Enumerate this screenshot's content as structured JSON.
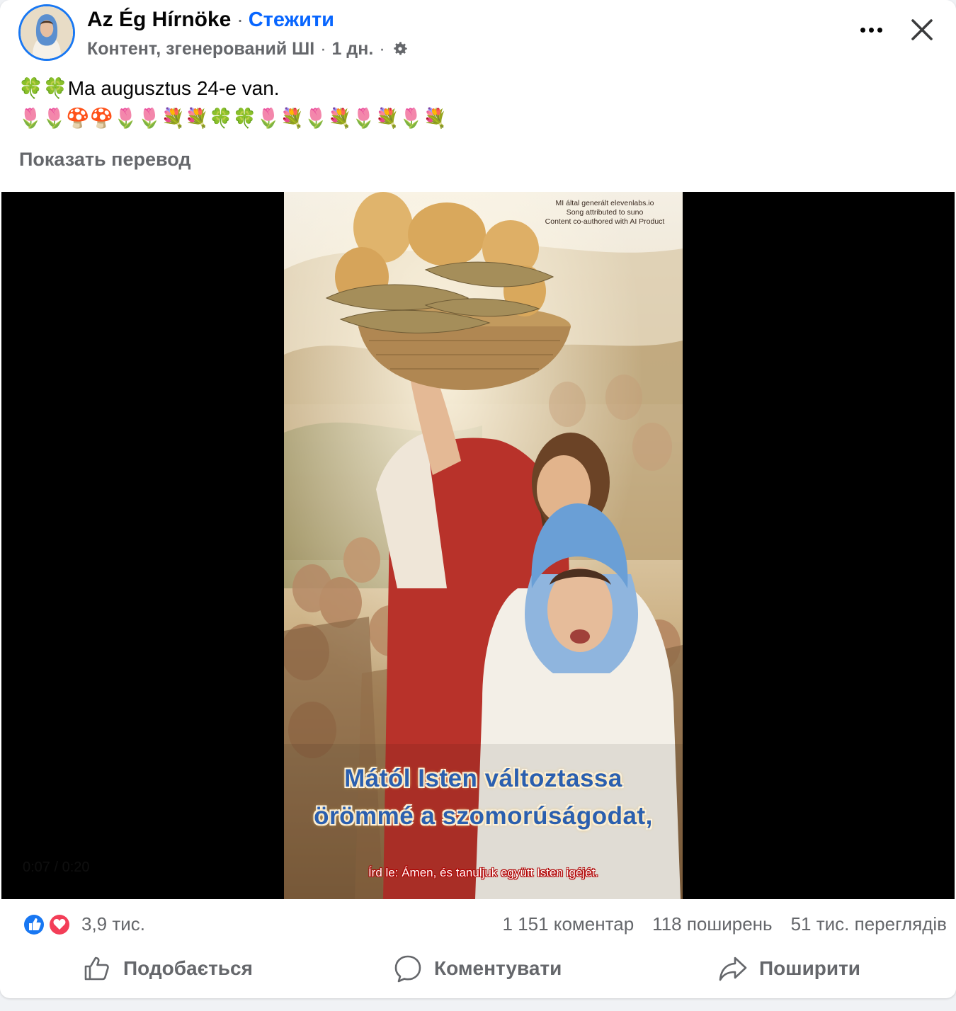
{
  "post": {
    "author": "Az Ég Hírnöke",
    "separator": "·",
    "follow_label": "Стежити",
    "meta": {
      "ai_label": "Контент, згенерований ШІ",
      "time": "1 дн.",
      "sep": "·"
    },
    "text_line1": "🍀🍀Ma augusztus 24-e van.",
    "text_line2": "🌷🌷🍄🍄🌷🌷💐💐🍀🍀🌷💐🌷💐🌷💐🌷💐",
    "see_translation": "Показать перевод"
  },
  "video": {
    "watermark": [
      "MI által generált elevenlabs.io",
      "Song attributed to suno",
      "Content co-authored with AI Product"
    ],
    "caption_line1": "Mától Isten változtassa",
    "caption_line2": "örömmé a szomorúságodat,",
    "subtitle": "Írd le: Ámen, és tanuljuk együtt Isten igéjét.",
    "player_time": "0:07 / 0:20"
  },
  "stats": {
    "reactions_count": "3,9 тис.",
    "comments": "1 151 коментар",
    "shares": "118 поширень",
    "views": "51 тис. переглядів"
  },
  "actions": {
    "like": "Подобається",
    "comment": "Коментувати",
    "share": "Поширити"
  },
  "colors": {
    "accent": "#0866ff",
    "secondary_text": "#65676b",
    "like_blue": "#1877f2",
    "love_red": "#f33e58",
    "caption_blue": "#2b5fae"
  },
  "icons": [
    "gear-icon",
    "more-icon",
    "close-icon",
    "like-reaction-icon",
    "love-reaction-icon",
    "thumb-up-icon",
    "comment-icon",
    "share-icon"
  ]
}
